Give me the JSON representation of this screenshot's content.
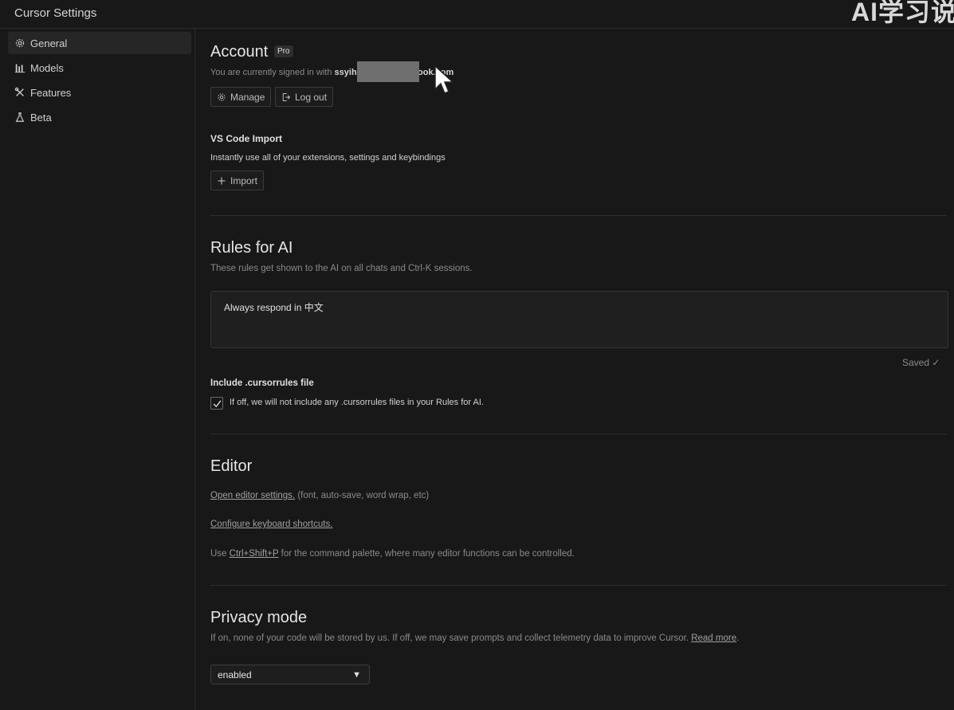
{
  "window": {
    "title": "Cursor Settings",
    "watermark": "AI学习说"
  },
  "sidebar": {
    "items": [
      {
        "label": "General",
        "icon": "gear-icon",
        "active": true
      },
      {
        "label": "Models",
        "icon": "bar-chart-icon",
        "active": false
      },
      {
        "label": "Features",
        "icon": "tools-icon",
        "active": false
      },
      {
        "label": "Beta",
        "icon": "flask-icon",
        "active": false
      }
    ]
  },
  "account": {
    "title": "Account",
    "badge": "Pro",
    "signed_in_prefix": "You are currently signed in with",
    "email_visible_start": "ssyihb",
    "email_visible_end": "ook.com",
    "manage_label": "Manage",
    "logout_label": "Log out"
  },
  "vscode_import": {
    "title": "VS Code Import",
    "description": "Instantly use all of your extensions, settings and keybindings",
    "import_label": "Import"
  },
  "rules": {
    "title": "Rules for AI",
    "description": "These rules get shown to the AI on all chats and Ctrl-K sessions.",
    "value": "Always respond in 中文",
    "saved_status": "Saved ✓",
    "include_title": "Include .cursorrules file",
    "include_checked": true,
    "include_description": "If off, we will not include any .cursorrules files in your Rules for AI."
  },
  "editor": {
    "title": "Editor",
    "open_settings_link": "Open editor settings.",
    "open_settings_suffix": " (font, auto-save, word wrap, etc)",
    "shortcuts_link": "Configure keyboard shortcuts.",
    "palette_prefix": "Use ",
    "palette_shortcut": "Ctrl+Shift+P",
    "palette_suffix": " for the command palette, where many editor functions can be controlled."
  },
  "privacy": {
    "title": "Privacy mode",
    "description": "If on, none of your code will be stored by us. If off, we may save prompts and collect telemetry data to improve Cursor. ",
    "read_more": "Read more",
    "period": ".",
    "selected": "enabled"
  }
}
